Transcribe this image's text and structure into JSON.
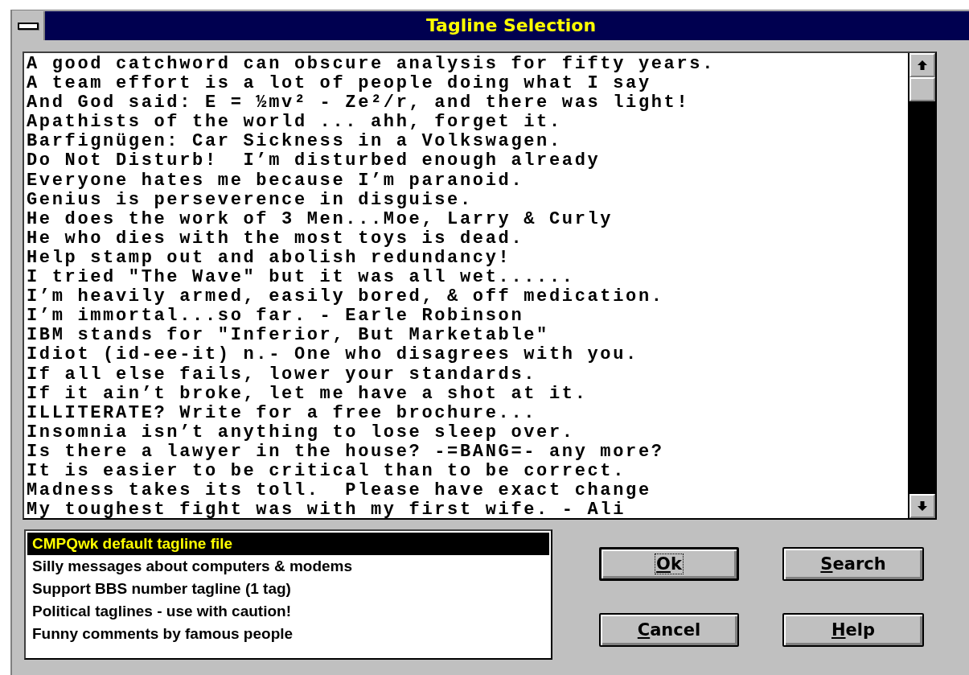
{
  "window": {
    "title": "Tagline Selection"
  },
  "taglines": [
    "A good catchword can obscure analysis for fifty years.",
    "A team effort is a lot of people doing what I say",
    "And God said: E = ½mv² - Ze²/r, and there was light!",
    "Apathists of the world ... ahh, forget it.",
    "Barfignügen: Car Sickness in a Volkswagen.",
    "Do Not Disturb!  I’m disturbed enough already",
    "Everyone hates me because I’m paranoid.",
    "Genius is perseverence in disguise.",
    "He does the work of 3 Men...Moe, Larry & Curly",
    "He who dies with the most toys is dead.",
    "Help stamp out and abolish redundancy!",
    "I tried \"The Wave\" but it was all wet......",
    "I’m heavily armed, easily bored, & off medication.",
    "I’m immortal...so far. - Earle Robinson",
    "IBM stands for \"Inferior, But Marketable\"",
    "Idiot (id-ee-it) n.- One who disagrees with you.",
    "If all else fails, lower your standards.",
    "If it ain’t broke, let me have a shot at it.",
    "ILLITERATE? Write for a free brochure...",
    "Insomnia isn’t anything to lose sleep over.",
    "Is there a lawyer in the house? -=BANG=- any more?",
    "It is easier to be critical than to be correct.",
    "Madness takes its toll.  Please have exact change",
    "My toughest fight was with my first wife. - Ali"
  ],
  "files": [
    {
      "label": "CMPQwk default tagline file",
      "selected": true
    },
    {
      "label": "Silly messages about computers & modems",
      "selected": false
    },
    {
      "label": "Support BBS number tagline (1 tag)",
      "selected": false
    },
    {
      "label": "Political taglines - use with caution!",
      "selected": false
    },
    {
      "label": "Funny comments by famous people",
      "selected": false
    }
  ],
  "buttons": [
    {
      "label": "Ok",
      "default": true
    },
    {
      "label": "Search",
      "default": false
    },
    {
      "label": "Cancel",
      "default": false
    },
    {
      "label": "Help",
      "default": false
    }
  ]
}
